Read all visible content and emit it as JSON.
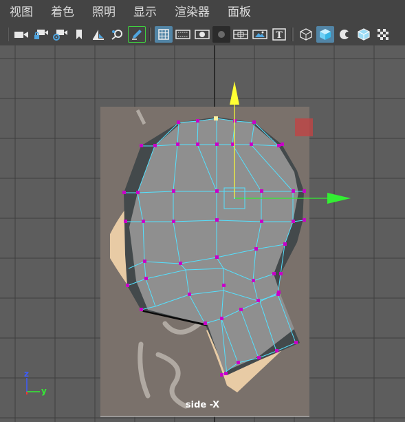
{
  "menubar": {
    "items": [
      "视图",
      "着色",
      "照明",
      "显示",
      "渲染器",
      "面板"
    ]
  },
  "toolbar": {
    "buttons": [
      {
        "icon": "select-camera-icon"
      },
      {
        "icon": "lock-camera-icon"
      },
      {
        "icon": "camera-attributes-icon"
      },
      {
        "icon": "bookmark-icon"
      },
      {
        "icon": "image-plane-icon"
      },
      {
        "icon": "2d-pan-zoom-icon"
      },
      {
        "icon": "grease-pencil-icon"
      },
      {
        "icon": "grid-icon",
        "active": true
      },
      {
        "icon": "film-gate-icon"
      },
      {
        "icon": "resolution-gate-icon"
      },
      {
        "icon": "gate-mask-icon"
      },
      {
        "icon": "field-chart-icon"
      },
      {
        "icon": "safe-action-icon"
      },
      {
        "icon": "safe-title-icon"
      },
      {
        "icon": "wireframe-icon"
      },
      {
        "icon": "smooth-shade-icon",
        "active": true
      },
      {
        "icon": "use-default-material-icon"
      },
      {
        "icon": "wireframe-on-shaded-icon"
      },
      {
        "icon": "xray-icon"
      }
    ]
  },
  "viewport": {
    "camera_label": "side -X",
    "axes": {
      "z": "z",
      "y": "y"
    },
    "colors": {
      "background": "#5d5d5d",
      "grid": "#3f3f3f",
      "mesh_face": "#8e8e8e",
      "mesh_dark": "#444a4c",
      "wire": "#54e1ff",
      "vertex": "#c800c8",
      "move_y_axis": "#ffff33",
      "move_z_axis": "#33ee33"
    }
  }
}
